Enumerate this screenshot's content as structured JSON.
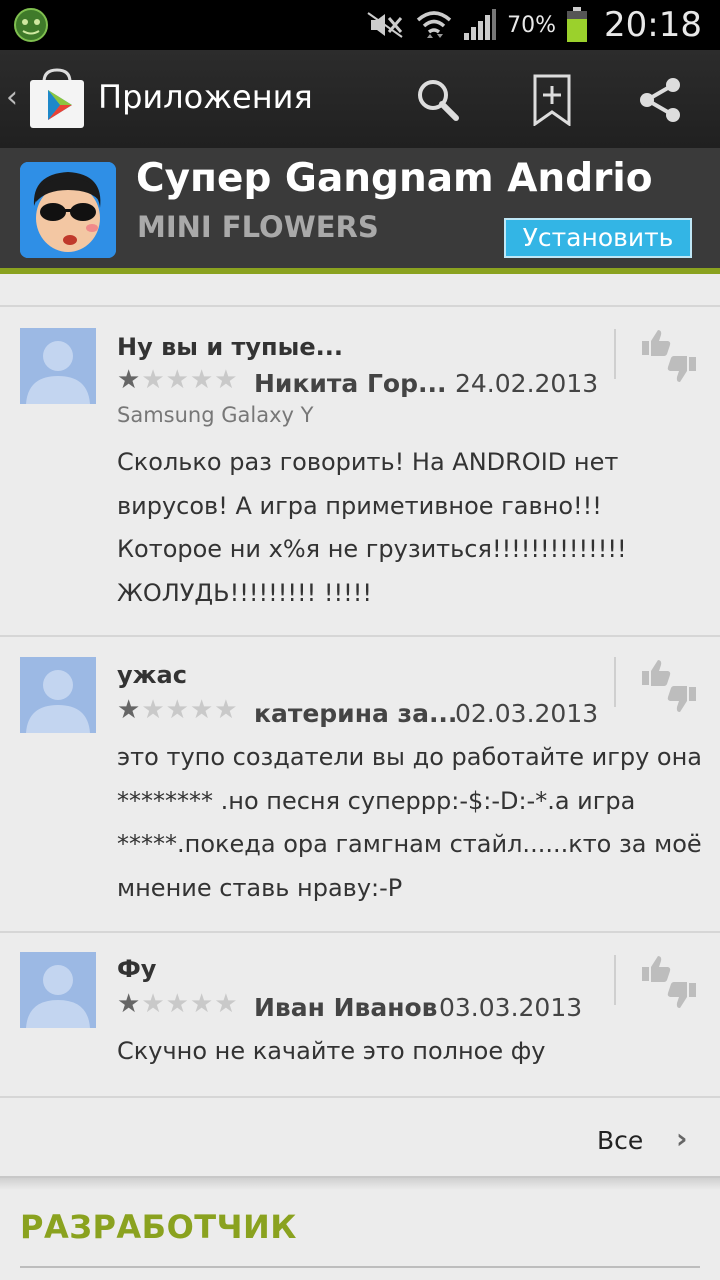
{
  "status_bar": {
    "battery_percent": "70%",
    "time": "20:18",
    "icons": [
      "app-notification-icon",
      "mute-icon",
      "wifi-icon",
      "signal-icon",
      "battery-icon"
    ]
  },
  "action_bar": {
    "title": "Приложения",
    "icons": [
      "play-store-icon",
      "search-icon",
      "bookmark-add-icon",
      "share-icon"
    ]
  },
  "app": {
    "title": "Супер Gangnam Andrio",
    "developer": "MINI FLOWERS",
    "install_label": "Установить"
  },
  "reviews": [
    {
      "title": "Ну вы и тупые...",
      "rating": 1,
      "max_rating": 5,
      "author": "Никита Гор...",
      "date": "24.02.2013",
      "device": "Samsung Galaxy Y",
      "text": "Сколько раз говорить! На ANDROID нет вирусов! А игра приметивное гавно!!! Которое ни х%я не грузиться!!!!!!!!!!!!!! ЖОЛУДЬ!!!!!!!!! !!!!!"
    },
    {
      "title": "ужас",
      "rating": 1,
      "max_rating": 5,
      "author": "катерина за...",
      "date": "02.03.2013",
      "device": "",
      "text": "это тупо создатели вы до работайте игру она ********  .но песня суперрр:-$:-D:-*.а игра *****.покеда ора гамгнам стайл......кто за моё мнение ставь нраву:-Р"
    },
    {
      "title": "Фу",
      "rating": 1,
      "max_rating": 5,
      "author": "Иван Иванов",
      "date": "03.03.2013",
      "device": "",
      "text": "Скучно не качайте это полное фу"
    }
  ],
  "all_link": {
    "label": "Все"
  },
  "developer_section": {
    "heading": "РАЗРАБОТЧИК"
  },
  "colors": {
    "accent_green": "#8aa21f",
    "install_blue": "#33b5e5",
    "header_gray": "#3a3a3a"
  }
}
